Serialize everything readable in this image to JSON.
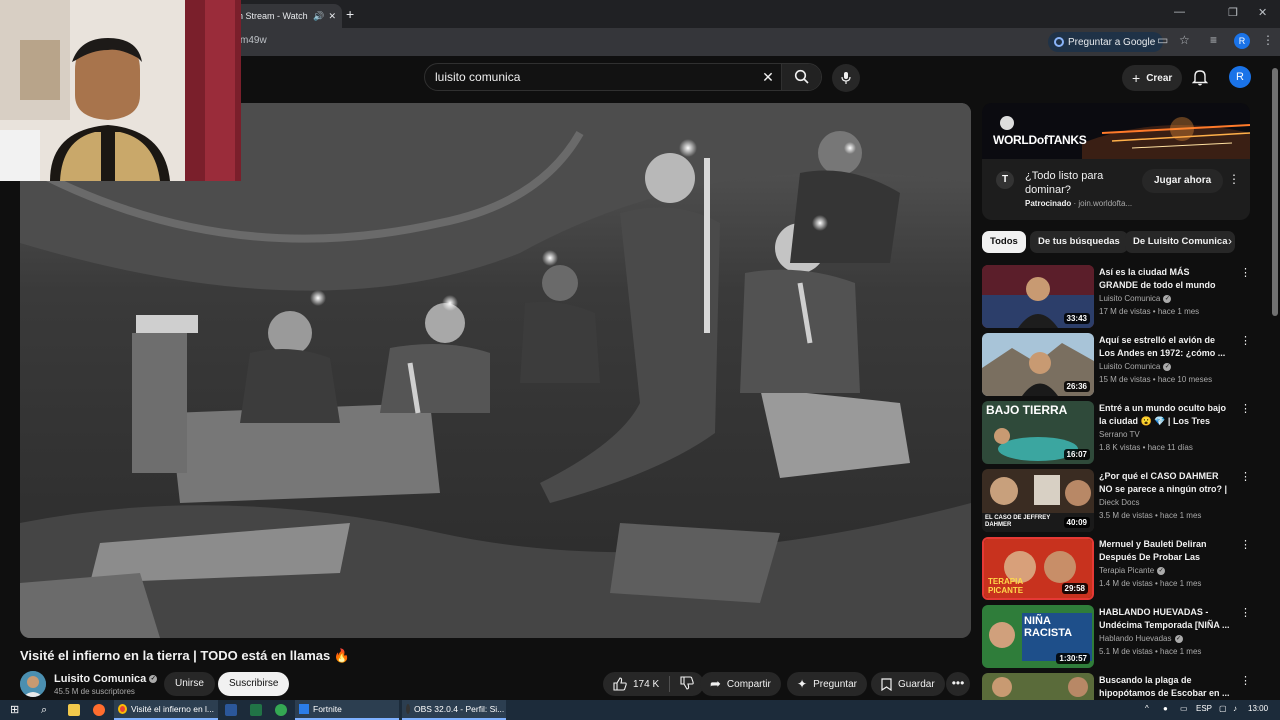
{
  "browser": {
    "tab_title": "n Stream - Watch",
    "url_fragment": "m49w",
    "ask_google": "Preguntar a Google",
    "profile_initial": "R"
  },
  "header": {
    "search_query": "luisito comunica",
    "create_label": "Crear",
    "avatar_initial": "R"
  },
  "video": {
    "title": "Visité el infierno en la tierra | TODO está en llamas 🔥",
    "channel": "Luisito Comunica",
    "subscribers": "45.5 M de suscriptores",
    "join_label": "Unirse",
    "subscribe_label": "Suscribirse",
    "likes": "174 K",
    "share_label": "Compartir",
    "ask_label": "Preguntar",
    "save_label": "Guardar"
  },
  "ad": {
    "banner_text": "WORLDofTANKS",
    "title": "¿Todo listo para dominar?",
    "sponsored": "Patrocinado",
    "domain": "join.worldofta...",
    "cta": "Jugar ahora"
  },
  "chips": [
    "Todos",
    "De tus búsquedas",
    "De Luisito Comunica"
  ],
  "recommendations": [
    {
      "title": "Así es la ciudad MÁS GRANDE de todo el mundo (impactante...",
      "channel": "Luisito Comunica",
      "verified": true,
      "meta": "17 M de vistas • hace 1 mes",
      "duration": "33:43",
      "thumb_color": "#8b2a2a"
    },
    {
      "title": "Aquí se estrelló el avión de Los Andes en 1972: ¿cómo ...",
      "channel": "Luisito Comunica",
      "verified": true,
      "meta": "15 M de vistas • hace 10 meses",
      "duration": "26:36",
      "thumb_color": "#6f8fa8"
    },
    {
      "title": "Entré a un mundo oculto bajo la ciudad 😮 💎 | Los Tres Ojos, ...",
      "channel": "Serrano TV",
      "verified": false,
      "meta": "1.8 K vistas • hace 11 días",
      "duration": "16:07",
      "thumb_color": "#3a6b55",
      "thumb_text": "BAJO TIERRA"
    },
    {
      "title": "¿Por qué el CASO DAHMER NO se parece a ningún otro? | ...",
      "channel": "Dieck Docs",
      "verified": false,
      "meta": "3.5 M de vistas • hace 1 mes",
      "duration": "40:09",
      "thumb_color": "#4a3a2e",
      "thumb_text": "EL CASO DE JEFFREY DAHMER"
    },
    {
      "title": "Mernuel y Bauleti Deliran Después De Probar Las Salsas...",
      "channel": "Terapia Picante",
      "verified": true,
      "meta": "1.4 M de vistas • hace 1 mes",
      "duration": "29:58",
      "thumb_color": "#c8321e",
      "thumb_text": "TERAPIA PICANTE"
    },
    {
      "title": "HABLANDO HUEVADAS - Undécima Temporada [NIÑA ...",
      "channel": "Hablando Huevadas",
      "verified": true,
      "meta": "5.1 M de vistas • hace 1 mes",
      "duration": "1:30:57",
      "thumb_color": "#2f7d3a",
      "thumb_text": "NIÑA RACISTA"
    },
    {
      "title": "Buscando la plaga de hipopótamos de Escobar en ...",
      "channel": "",
      "verified": false,
      "meta": "",
      "duration": "",
      "thumb_color": "#5a6b3a"
    }
  ],
  "taskbar": {
    "chrome_title": "Visité el infierno en l...",
    "fortnite": "Fortnite",
    "obs": "OBS 32.0.4 - Perfil: Si...",
    "lang": "ESP",
    "time": "13:00"
  }
}
